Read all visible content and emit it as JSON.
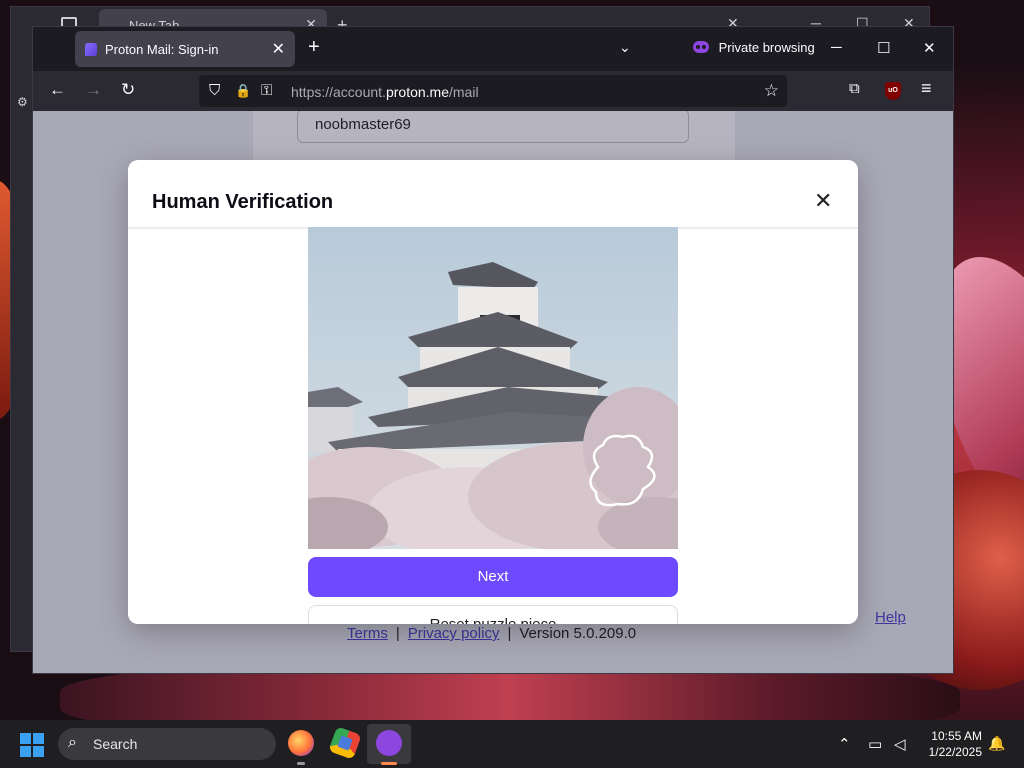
{
  "background_window": {
    "tab_title": "New Tab",
    "close_glyph": "✕",
    "new_tab_glyph": "+",
    "minimize_glyph": "─",
    "maximize_glyph": "☐",
    "window_close_glyph": "✕",
    "side_glyph": "⚙"
  },
  "browser": {
    "tab_title": "Proton Mail: Sign-in",
    "tab_close_glyph": "✕",
    "new_tab_glyph": "+",
    "list_tabs_glyph": "⌄",
    "private_label": "Private browsing",
    "minimize_glyph": "─",
    "maximize_glyph": "☐",
    "close_glyph": "✕",
    "back_glyph": "←",
    "forward_glyph": "→",
    "reload_glyph": "↻",
    "url_prefix": "https://account.",
    "url_domain": "proton.me",
    "url_path": "/mail",
    "shield_glyph": "⛉",
    "lock_glyph": "🔒",
    "key_glyph": "⚿",
    "bookmark_glyph": "☆",
    "extensions_glyph": "⧉",
    "ublock_label": "uO",
    "menu_glyph": "≡",
    "accent_color": "#8d46e0"
  },
  "page": {
    "username_value": "noobmaster69",
    "footer": {
      "terms": "Terms",
      "privacy": "Privacy policy",
      "separator": "|",
      "version": "Version 5.0.209.0"
    },
    "help": "Help"
  },
  "modal": {
    "title": "Human Verification",
    "close_glyph": "✕",
    "next_label": "Next",
    "reset_label": "Reset puzzle piece",
    "primary_color": "#6d4aff"
  },
  "taskbar": {
    "search_placeholder": "Search",
    "search_glyph": "⌕",
    "tray_chevron": "⌃",
    "time": "10:55 AM",
    "date": "1/22/2025",
    "bell_glyph": "🔔"
  }
}
